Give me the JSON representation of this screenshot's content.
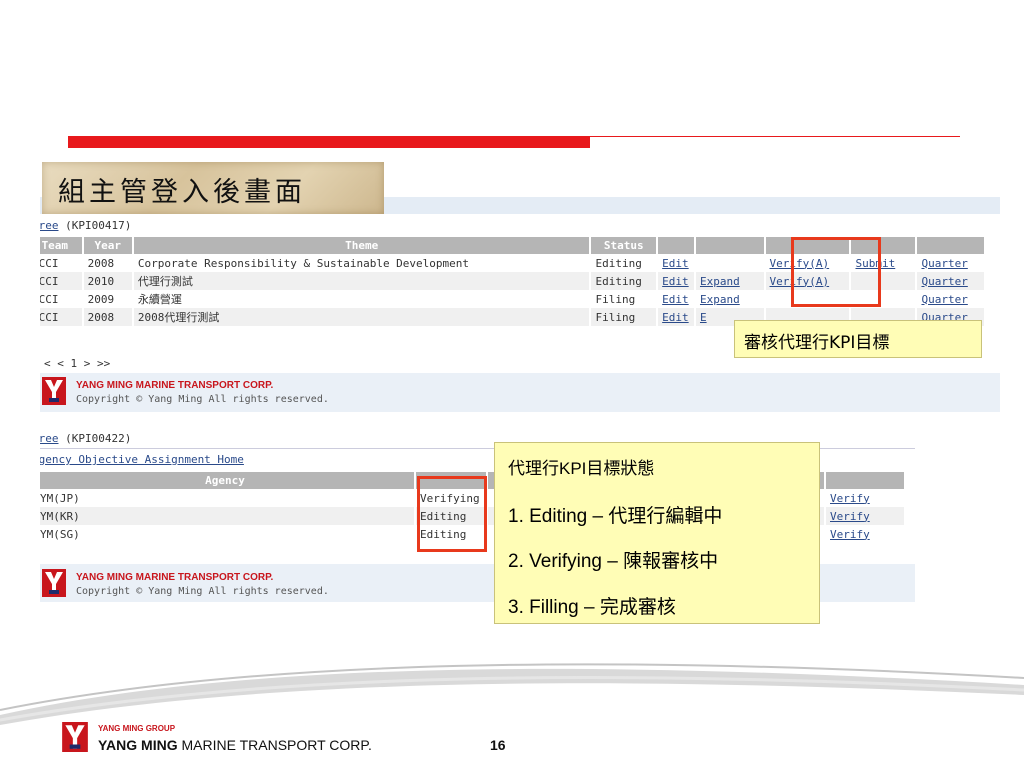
{
  "slide": {
    "title": "組主管登入後畫面",
    "page_number": "16"
  },
  "screen1": {
    "breadcrumb_link": "Tree",
    "breadcrumb_id": "(KPI00417)",
    "columns": [
      "Team",
      "Year",
      "Theme",
      "Status",
      "",
      "",
      "",
      "",
      ""
    ],
    "rows": [
      {
        "team": "GCCI",
        "year": "2008",
        "theme": "Corporate Responsibility & Sustainable Development",
        "status": "Editing",
        "edit": "Edit",
        "expand": "",
        "verify": "Verify(A)",
        "submit": "Submit",
        "quarter": "Quarter"
      },
      {
        "team": "GCCI",
        "year": "2010",
        "theme": "代理行測試",
        "status": "Editing",
        "edit": "Edit",
        "expand": "Expand",
        "verify": "Verify(A)",
        "submit": "",
        "quarter": "Quarter"
      },
      {
        "team": "GCCI",
        "year": "2009",
        "theme": "永續營運",
        "status": "Filing",
        "edit": "Edit",
        "expand": "Expand",
        "verify": "",
        "submit": "",
        "quarter": "Quarter"
      },
      {
        "team": "GCCI",
        "year": "2008",
        "theme": "2008代理行測試",
        "status": "Filing",
        "edit": "Edit",
        "expand": "E",
        "verify": "",
        "submit": "",
        "quarter": "Quarter"
      }
    ],
    "pager": "< < 1 > >>",
    "footer_corp": "YANG MING MARINE TRANSPORT CORP.",
    "footer_copy": "Copyright © Yang Ming All rights reserved."
  },
  "screen2": {
    "breadcrumb_link": "Tree",
    "breadcrumb_id": "(KPI00422)",
    "home_link": "Agency Objective Assignment Home",
    "column_agency": "Agency",
    "rows": [
      {
        "agency": "YM(JP)",
        "status": "Verifying",
        "verify": "Verify"
      },
      {
        "agency": "YM(KR)",
        "status": "Editing",
        "verify": "Verify"
      },
      {
        "agency": "YM(SG)",
        "status": "Editing",
        "verify": "Verify"
      }
    ],
    "footer_corp": "YANG MING MARINE TRANSPORT CORP.",
    "footer_copy": "Copyright © Yang Ming All rights reserved."
  },
  "callouts": {
    "verify_note": "審核代理行KPI目標",
    "status_title": "代理行KPI目標狀態",
    "status_1": "1. Editing – 代理行編輯中",
    "status_2": "2. Verifying – 陳報審核中",
    "status_3": "3. Filling – 完成審核"
  },
  "footer": {
    "group": "YANG MING GROUP",
    "corp_bold": "YANG MING",
    "corp_rest": " MARINE TRANSPORT CORP."
  },
  "colors": {
    "accent_red": "#e8191c",
    "callout_yellow": "#fffdb6",
    "header_gray": "#b5b5b5",
    "link_blue": "#2a4a8a"
  }
}
